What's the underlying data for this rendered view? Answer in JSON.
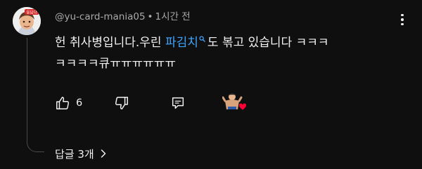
{
  "comment": {
    "author": "@yu-card-mania05",
    "separator": "•",
    "time": "1시간 전",
    "avatar_badge": "응답다",
    "text_line1_before": "헌 취사병입니다.우린 ",
    "text_link": "파김치",
    "text_line1_after": "도 볶고 있습니다 ㅋㅋㅋ",
    "text_line2": "ㅋㅋㅋㅋ큐ㅠㅠㅠㅠㅠㅠ",
    "likes": "6",
    "replies_label": "답글 3개"
  },
  "colors": {
    "background": "#0f0f0f",
    "text": "#f1f1f1",
    "muted": "#aaaaaa",
    "link": "#3ea6ff",
    "heart": "#ff0033"
  },
  "icons": [
    "thumbs-up-icon",
    "thumbs-down-icon",
    "reply-icon",
    "creator-heart-icon",
    "search-icon",
    "chevron-right-icon",
    "more-vert-icon"
  ]
}
